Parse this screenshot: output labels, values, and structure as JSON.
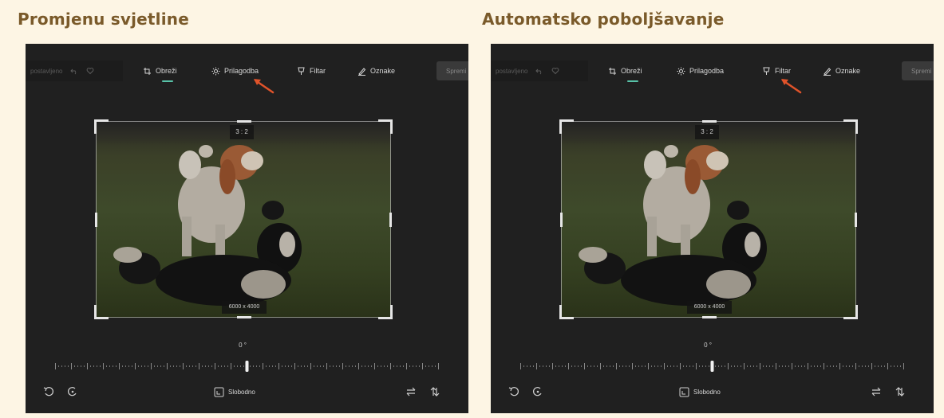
{
  "panels": [
    {
      "title": "Promjenu svjetline",
      "toolbar": {
        "ghost_label": "postavljeno",
        "items": [
          {
            "label": "Obreži",
            "icon": "crop-icon"
          },
          {
            "label": "Prilagodba",
            "icon": "brightness-icon"
          },
          {
            "label": "Filtar",
            "icon": "filter-icon"
          },
          {
            "label": "Oznake",
            "icon": "markup-icon"
          }
        ],
        "save_label": "Spremi",
        "active": "Obreži",
        "arrow_target": "Prilagodba"
      },
      "crop": {
        "ratio": "3 : 2",
        "size": "6000 x 4000"
      },
      "rotation": {
        "angle": "0 °"
      },
      "bottom": {
        "free_label": "Slobodno"
      }
    },
    {
      "title": "Automatsko poboljšavanje",
      "toolbar": {
        "ghost_label": "postavljeno",
        "items": [
          {
            "label": "Obreži",
            "icon": "crop-icon"
          },
          {
            "label": "Prilagodba",
            "icon": "brightness-icon"
          },
          {
            "label": "Filtar",
            "icon": "filter-icon"
          },
          {
            "label": "Oznake",
            "icon": "markup-icon"
          }
        ],
        "save_label": "Spremi",
        "active": "Obreži",
        "arrow_target": "Filtar"
      },
      "crop": {
        "ratio": "3 : 2",
        "size": "6000 x 4000"
      },
      "rotation": {
        "angle": "0 °"
      },
      "bottom": {
        "free_label": "Slobodno"
      }
    }
  ],
  "colors": {
    "accent": "#58c2a8",
    "annotation_arrow": "#e0532a",
    "title": "#7a5a2a",
    "background": "#fdf5e4",
    "screen": "#202020"
  }
}
